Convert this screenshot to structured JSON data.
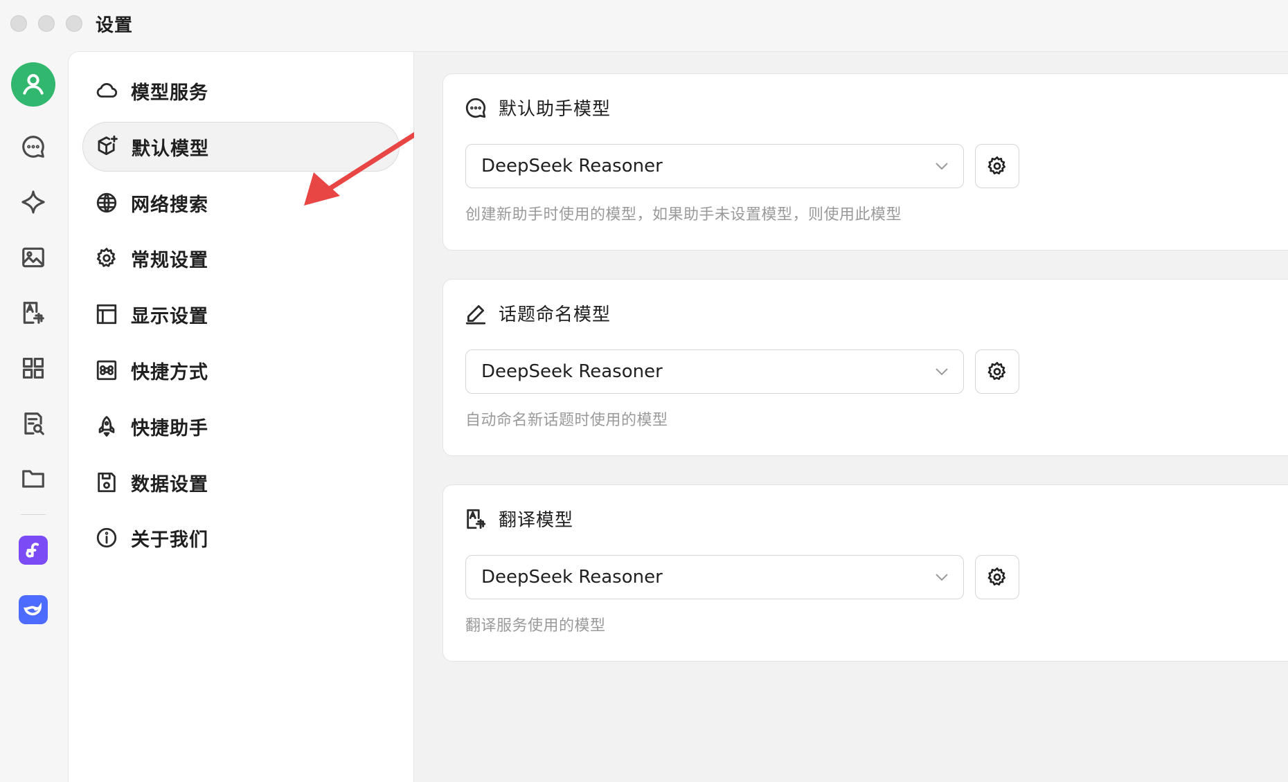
{
  "window": {
    "title": "设置",
    "traffic_lights": [
      "close",
      "minimize",
      "zoom"
    ]
  },
  "rail": {
    "items": [
      {
        "icon": "user-avatar-icon",
        "active": true
      },
      {
        "icon": "chat-bubble-icon"
      },
      {
        "icon": "sparkle-icon"
      },
      {
        "icon": "image-icon"
      },
      {
        "icon": "translate-icon"
      },
      {
        "icon": "apps-grid-icon"
      },
      {
        "icon": "document-search-icon"
      },
      {
        "icon": "folder-icon"
      }
    ],
    "apps": [
      {
        "icon": "fn-app-icon",
        "color": "#7b4bf5"
      },
      {
        "icon": "deepseek-app-icon",
        "color": "#4d6bfe"
      }
    ]
  },
  "nav": {
    "items": [
      {
        "label": "模型服务",
        "icon": "cloud-icon"
      },
      {
        "label": "默认模型",
        "icon": "cube-sparkle-icon",
        "active": true
      },
      {
        "label": "网络搜索",
        "icon": "globe-icon"
      },
      {
        "label": "常规设置",
        "icon": "gear-icon"
      },
      {
        "label": "显示设置",
        "icon": "layout-icon"
      },
      {
        "label": "快捷方式",
        "icon": "command-key-icon"
      },
      {
        "label": "快捷助手",
        "icon": "rocket-icon"
      },
      {
        "label": "数据设置",
        "icon": "save-disk-icon"
      },
      {
        "label": "关于我们",
        "icon": "info-icon"
      }
    ]
  },
  "cards": [
    {
      "title": "默认助手模型",
      "icon": "chat-dots-icon",
      "model": "DeepSeek Reasoner",
      "description": "创建新助手时使用的模型，如果助手未设置模型，则使用此模型"
    },
    {
      "title": "话题命名模型",
      "icon": "pencil-icon",
      "model": "DeepSeek Reasoner",
      "description": "自动命名新话题时使用的模型"
    },
    {
      "title": "翻译模型",
      "icon": "translate-icon",
      "model": "DeepSeek Reasoner",
      "description": "翻译服务使用的模型"
    }
  ],
  "colors": {
    "avatar": "#32b76f",
    "annotation_arrow": "#e84545",
    "active_nav_bg": "#f2f2f2"
  }
}
